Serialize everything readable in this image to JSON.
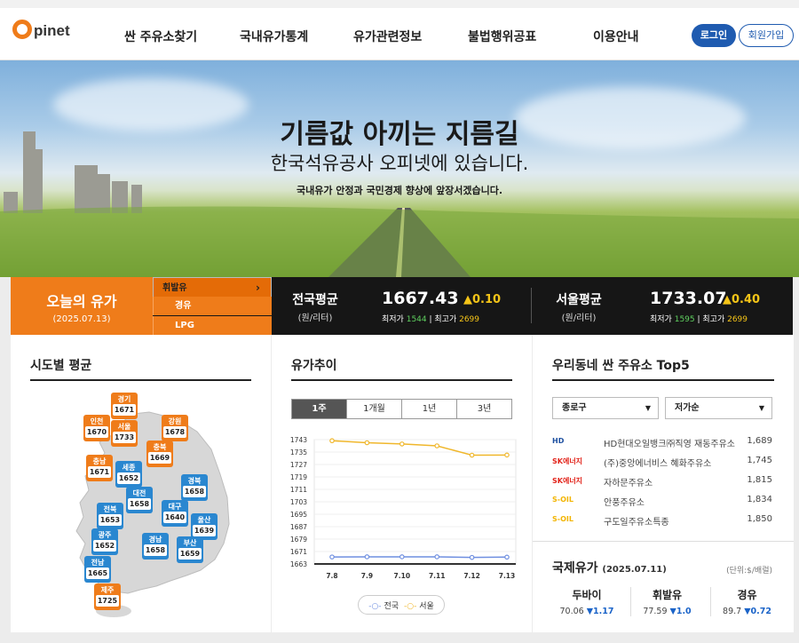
{
  "brand": {
    "logo_letter": "O",
    "logo_text": "pinet"
  },
  "nav": [
    "싼 주유소찾기",
    "국내유가통계",
    "유가관련정보",
    "불법행위공표",
    "이용안내"
  ],
  "auth": {
    "login": "로그인",
    "join": "회원가입"
  },
  "hero": {
    "headline": "기름값 아끼는 지름길",
    "subheadline": "한국석유공사 오피넷에 있습니다.",
    "tagline": "국내유가 안정과 국민경제 향상에 앞장서겠습니다."
  },
  "today": {
    "title": "오늘의 유가",
    "date": "(2025.07.13)",
    "fuels": [
      "휘발유",
      "경유",
      "LPG"
    ],
    "arrow": "›",
    "national": {
      "label": "전국평균",
      "unit": "(원/리터)",
      "price": "1667.43",
      "change": "▲0.10",
      "min_label": "최저가",
      "min": "1544",
      "max_label": "최고가",
      "max": "2699"
    },
    "seoul": {
      "label": "서울평균",
      "unit": "(원/리터)",
      "price": "1733.07",
      "change": "▲0.40",
      "min_label": "최저가",
      "min": "1595",
      "max_label": "최고가",
      "max": "2699"
    }
  },
  "regions": {
    "title": "시도별 평균",
    "items": [
      {
        "name": "경기",
        "value": "1671"
      },
      {
        "name": "인천",
        "value": "1670"
      },
      {
        "name": "서울",
        "value": "1733"
      },
      {
        "name": "강원",
        "value": "1678"
      },
      {
        "name": "충북",
        "value": "1669"
      },
      {
        "name": "충남",
        "value": "1671"
      },
      {
        "name": "세종",
        "value": "1652"
      },
      {
        "name": "경북",
        "value": "1658"
      },
      {
        "name": "대전",
        "value": "1658"
      },
      {
        "name": "전북",
        "value": "1653"
      },
      {
        "name": "대구",
        "value": "1640"
      },
      {
        "name": "울산",
        "value": "1639"
      },
      {
        "name": "광주",
        "value": "1652"
      },
      {
        "name": "경남",
        "value": "1658"
      },
      {
        "name": "부산",
        "value": "1659"
      },
      {
        "name": "전남",
        "value": "1665"
      },
      {
        "name": "제주",
        "value": "1725"
      }
    ]
  },
  "trend": {
    "title": "유가추이",
    "tabs": [
      "1주",
      "1개월",
      "1년",
      "3년"
    ]
  },
  "chart_data": {
    "type": "line",
    "x": [
      "7.8",
      "7.9",
      "7.10",
      "7.11",
      "7.12",
      "7.13"
    ],
    "series": [
      {
        "name": "전국",
        "color": "#6f8fe0",
        "values": [
          1667.5,
          1667.6,
          1667.6,
          1667.6,
          1667.2,
          1667.4
        ]
      },
      {
        "name": "서울",
        "color": "#f0b72c",
        "values": [
          1742.3,
          1741.0,
          1740.2,
          1739.0,
          1733.0,
          1733.1
        ]
      }
    ],
    "yticks": [
      1663,
      1671,
      1679,
      1687,
      1695,
      1703,
      1711,
      1719,
      1727,
      1735,
      1743
    ],
    "ylim": [
      1663,
      1743
    ]
  },
  "top5": {
    "title": "우리동네 싼 주유소 Top5",
    "district": "종로구",
    "sort": "저가순",
    "stations": [
      {
        "brand": "HD",
        "brand_color": "#1d4fa0",
        "name": "HD현대오일뱅크㈜직영 재동주유소",
        "price": "1,689"
      },
      {
        "brand": "SK에너지",
        "brand_color": "#e2231a",
        "name": "(주)중앙에너비스 혜화주유소",
        "price": "1,745"
      },
      {
        "brand": "SK에너지",
        "brand_color": "#e2231a",
        "name": "자하문주유소",
        "price": "1,815"
      },
      {
        "brand": "S-OIL",
        "brand_color": "#f2b400",
        "name": "안풍주유소",
        "price": "1,834"
      },
      {
        "brand": "S-OIL",
        "brand_color": "#f2b400",
        "name": "구도일주유소특종",
        "price": "1,850"
      }
    ]
  },
  "intl": {
    "title": "국제유가",
    "date": "(2025.07.11)",
    "unit": "(단위:$/배럴)",
    "items": [
      {
        "name": "두바이",
        "value": "70.06",
        "change": "▼1.17"
      },
      {
        "name": "휘발유",
        "value": "77.59",
        "change": "▼1.0"
      },
      {
        "name": "경유",
        "value": "89.7",
        "change": "▼0.72"
      }
    ]
  }
}
